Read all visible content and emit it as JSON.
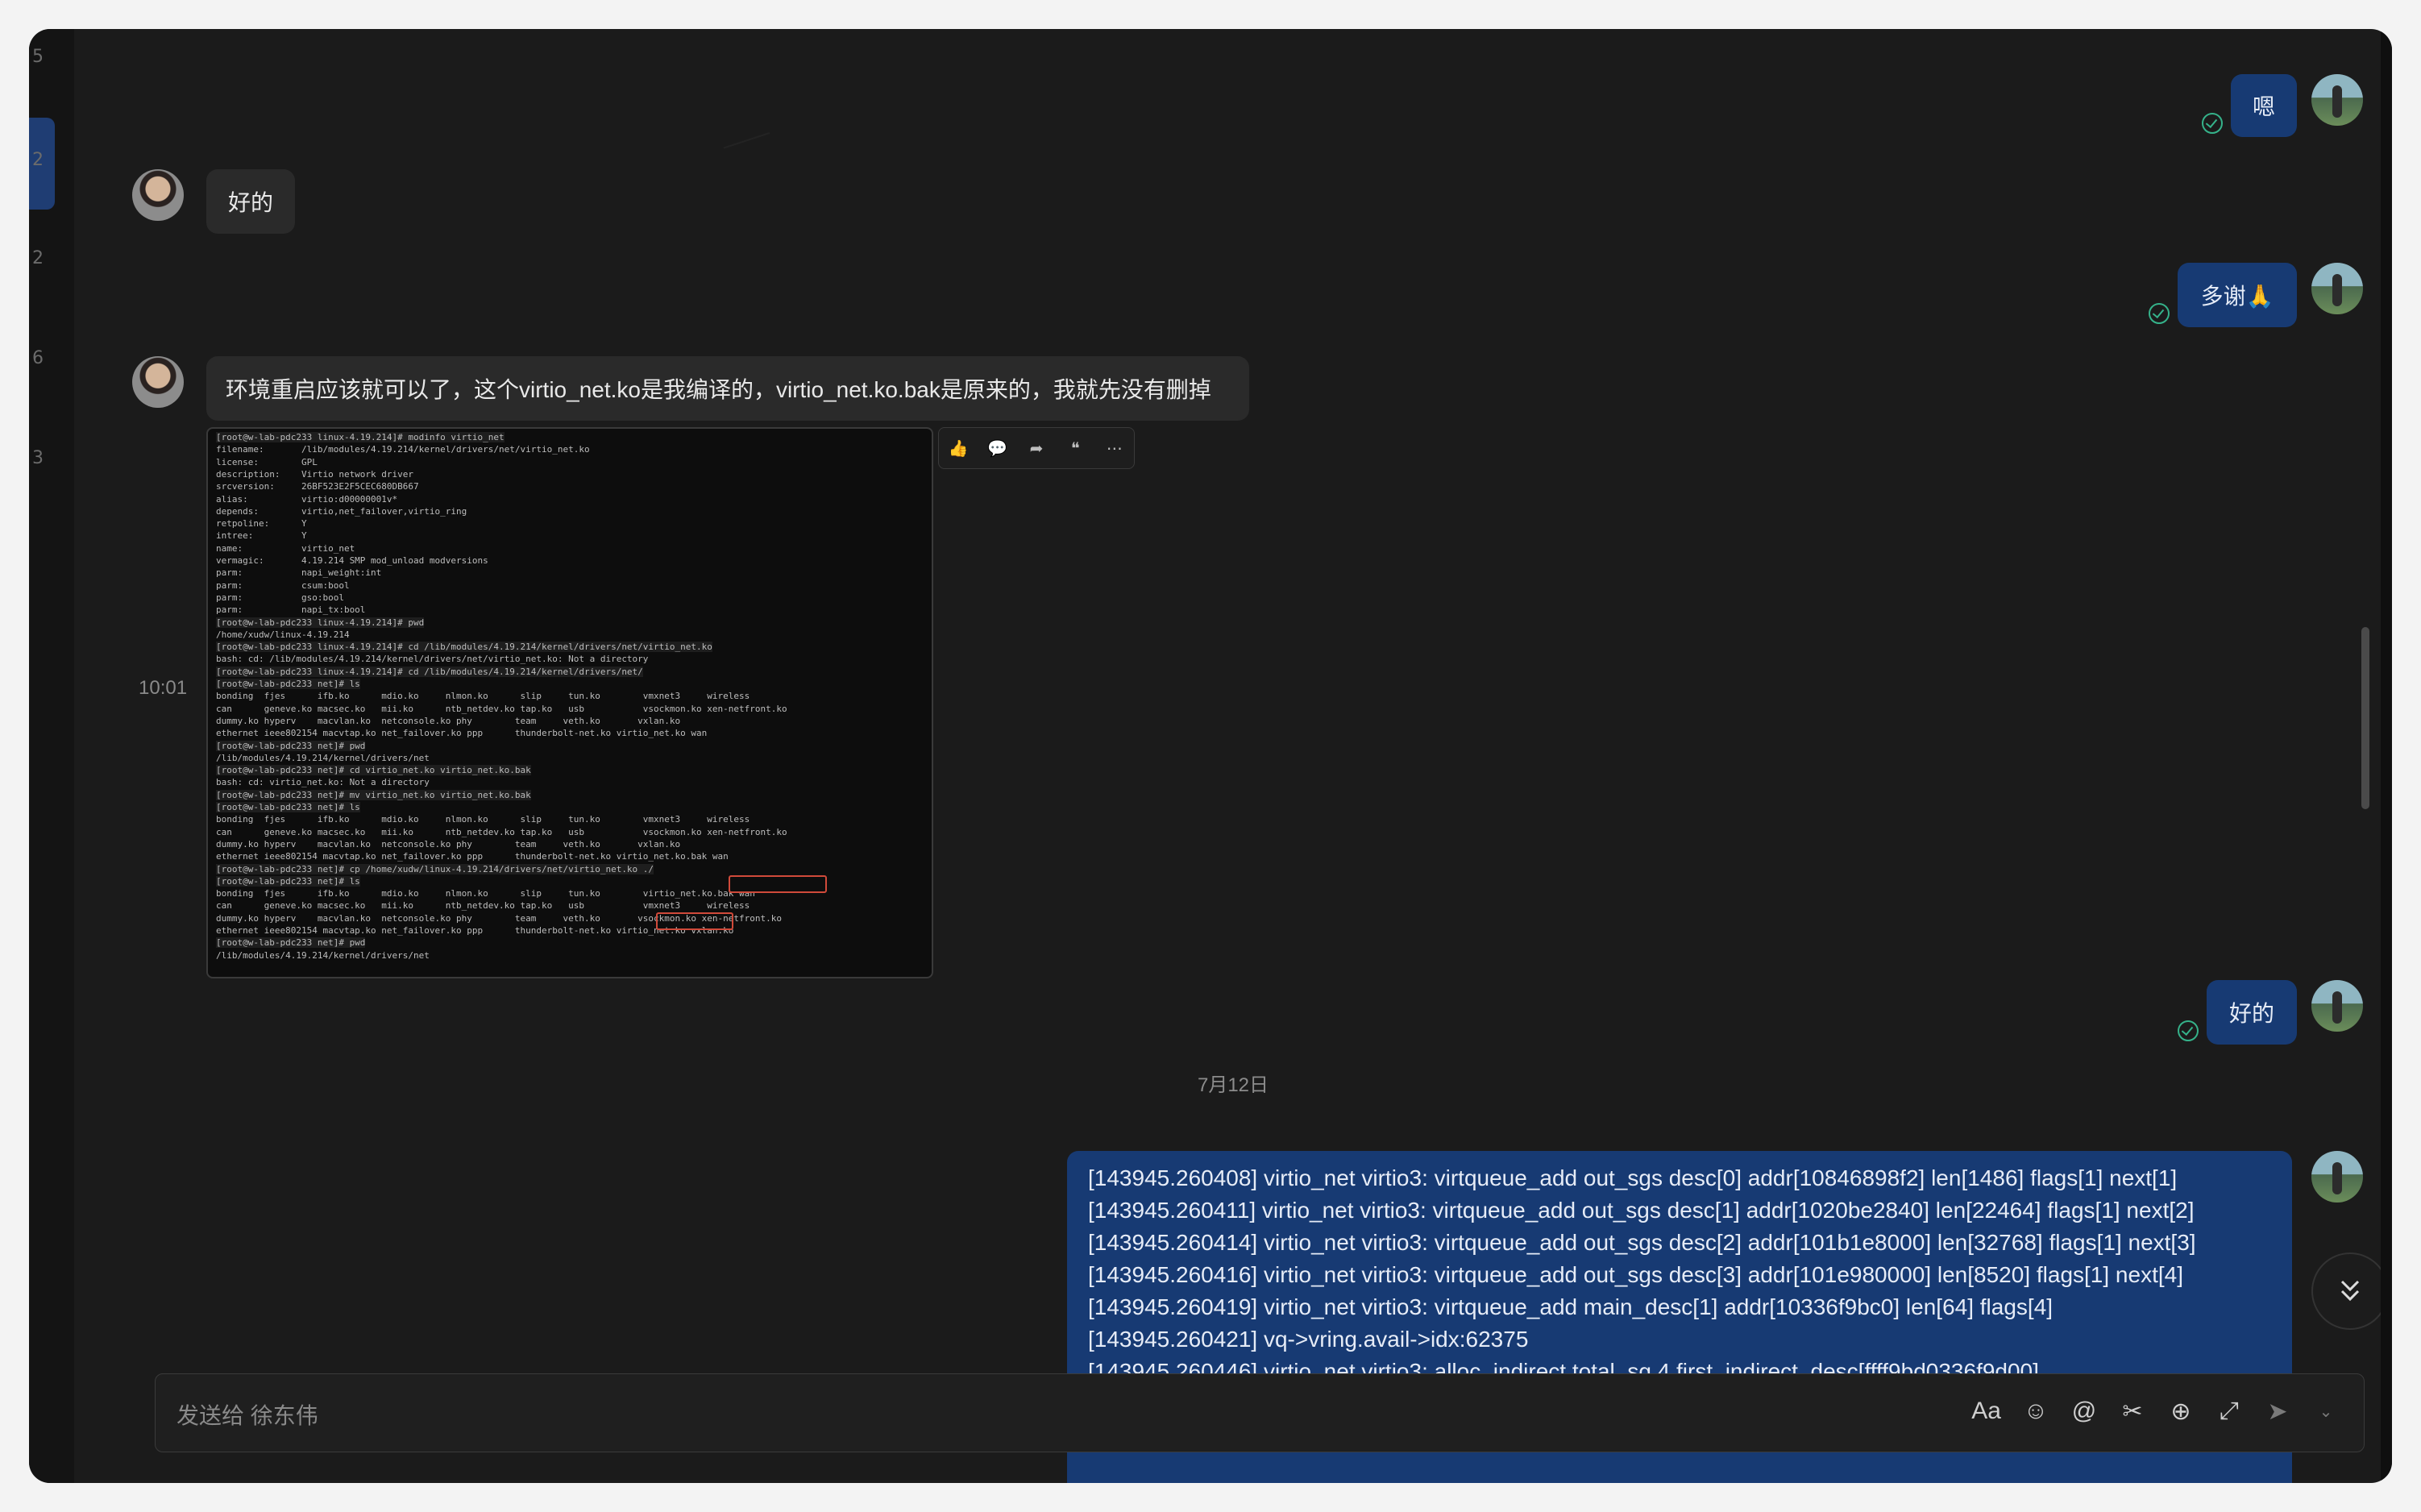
{
  "window": {
    "left_rail_ticks": [
      "5",
      "2",
      "2",
      "6",
      "3"
    ]
  },
  "messages": {
    "out_1": "嗯",
    "in_1": "好的",
    "out_2": "多谢🙏",
    "in_2": "环境重启应该就可以了，这个virtio_net.ko是我编译的，virtio_net.ko.bak是原来的，我就先没有删掉",
    "in_2_time": "10:01",
    "out_3": "好的"
  },
  "screenshot_terminal": {
    "lines": [
      "[root@w-lab-pdc233 linux-4.19.214]# modinfo virtio_net",
      "filename:       /lib/modules/4.19.214/kernel/drivers/net/virtio_net.ko",
      "license:        GPL",
      "description:    Virtio network driver",
      "srcversion:     26BF523E2F5CEC680DB667",
      "alias:          virtio:d00000001v*",
      "depends:        virtio,net_failover,virtio_ring",
      "retpoline:      Y",
      "intree:         Y",
      "name:           virtio_net",
      "vermagic:       4.19.214 SMP mod_unload modversions",
      "parm:           napi_weight:int",
      "parm:           csum:bool",
      "parm:           gso:bool",
      "parm:           napi_tx:bool",
      "[root@w-lab-pdc233 linux-4.19.214]# pwd",
      "/home/xudw/linux-4.19.214",
      "[root@w-lab-pdc233 linux-4.19.214]# cd /lib/modules/4.19.214/kernel/drivers/net/virtio_net.ko",
      "bash: cd: /lib/modules/4.19.214/kernel/drivers/net/virtio_net.ko: Not a directory",
      "[root@w-lab-pdc233 linux-4.19.214]# cd /lib/modules/4.19.214/kernel/drivers/net/",
      "[root@w-lab-pdc233 net]# ls",
      "bonding  fjes      ifb.ko      mdio.ko     nlmon.ko      slip     tun.ko        vmxnet3     wireless",
      "can      geneve.ko macsec.ko   mii.ko      ntb_netdev.ko tap.ko   usb           vsockmon.ko xen-netfront.ko",
      "dummy.ko hyperv    macvlan.ko  netconsole.ko phy        team     veth.ko       vxlan.ko",
      "ethernet ieee802154 macvtap.ko net_failover.ko ppp      thunderbolt-net.ko virtio_net.ko wan",
      "[root@w-lab-pdc233 net]# pwd",
      "/lib/modules/4.19.214/kernel/drivers/net",
      "[root@w-lab-pdc233 net]# cd virtio_net.ko virtio_net.ko.bak",
      "bash: cd: virtio_net.ko: Not a directory",
      "[root@w-lab-pdc233 net]# mv virtio_net.ko virtio_net.ko.bak",
      "[root@w-lab-pdc233 net]# ls",
      "bonding  fjes      ifb.ko      mdio.ko     nlmon.ko      slip     tun.ko        vmxnet3     wireless",
      "can      geneve.ko macsec.ko   mii.ko      ntb_netdev.ko tap.ko   usb           vsockmon.ko xen-netfront.ko",
      "dummy.ko hyperv    macvlan.ko  netconsole.ko phy        team     veth.ko       vxlan.ko",
      "ethernet ieee802154 macvtap.ko net_failover.ko ppp      thunderbolt-net.ko virtio_net.ko.bak wan",
      "[root@w-lab-pdc233 net]# cp /home/xudw/linux-4.19.214/drivers/net/virtio_net.ko ./",
      "[root@w-lab-pdc233 net]# ls",
      "bonding  fjes      ifb.ko      mdio.ko     nlmon.ko      slip     tun.ko        virtio_net.ko.bak wan",
      "can      geneve.ko macsec.ko   mii.ko      ntb_netdev.ko tap.ko   usb           vmxnet3     wireless",
      "dummy.ko hyperv    macvlan.ko  netconsole.ko phy        team     veth.ko       vsockmon.ko xen-netfront.ko",
      "ethernet ieee802154 macvtap.ko net_failover.ko ppp      thunderbolt-net.ko virtio_net.ko vxlan.ko",
      "[root@w-lab-pdc233 net]# pwd",
      "/lib/modules/4.19.214/kernel/drivers/net"
    ]
  },
  "date_separator": "7月12日",
  "log_message": {
    "lines": [
      "[143945.260408] virtio_net virtio3: virtqueue_add out_sgs desc[0] addr[10846898f2] len[1486] flags[1] next[1]",
      "[143945.260411] virtio_net virtio3: virtqueue_add out_sgs desc[1] addr[1020be2840] len[22464] flags[1] next[2]",
      "[143945.260414] virtio_net virtio3: virtqueue_add out_sgs desc[2] addr[101b1e8000] len[32768] flags[1] next[3]",
      "[143945.260416] virtio_net virtio3: virtqueue_add out_sgs desc[3] addr[101e980000] len[8520] flags[1] next[4]",
      "[143945.260419] virtio_net virtio3: virtqueue_add main_desc[1] addr[10336f9bc0] len[64] flags[4]",
      "[143945.260421] vq->vring.avail->idx:62375",
      "[143945.260446] virtio_net virtio3: alloc_indirect total_sg 4 first_indirect_desc[ffff9bd0336f9d00]"
    ]
  },
  "composer": {
    "placeholder": "发送给 徐东伟",
    "font_icon_label": "Aa"
  },
  "icons": {
    "message_toolbar": [
      "thumbs-up-icon",
      "comment-icon",
      "forward-icon",
      "quote-icon",
      "more-icon"
    ],
    "composer": [
      "font-icon",
      "emoji-icon",
      "mention-icon",
      "scissors-icon",
      "plus-icon",
      "expand-icon",
      "send-icon"
    ]
  },
  "colors": {
    "outgoing_bubble": "#173a73",
    "incoming_bubble": "#2a2a2a",
    "background": "#1b1b1b",
    "read_check": "#35b28a"
  }
}
